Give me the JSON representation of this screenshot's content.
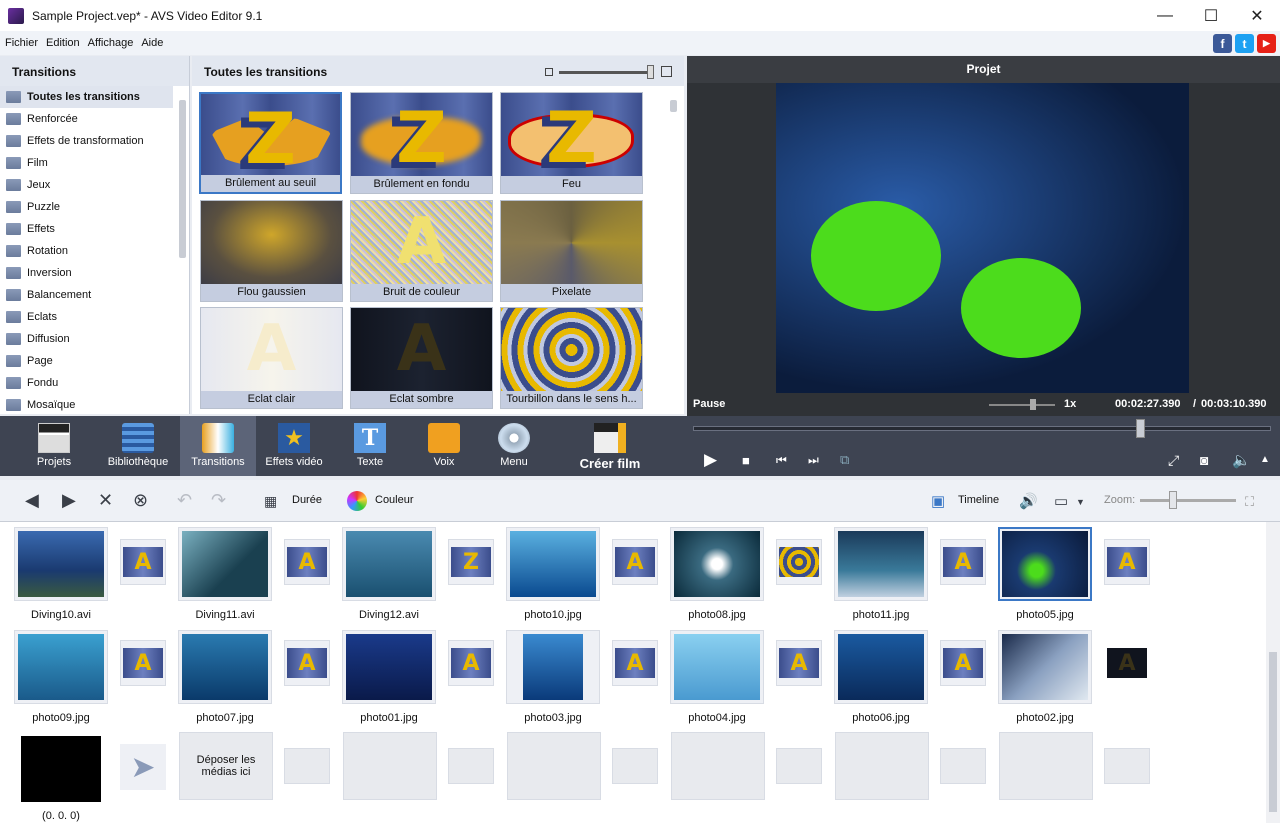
{
  "window": {
    "title": "Sample Project.vep* - AVS Video Editor 9.1",
    "minimize": "—",
    "maximize": "☐",
    "close": "✕"
  },
  "menu": [
    "Fichier",
    "Edition",
    "Affichage",
    "Aide"
  ],
  "social": {
    "facebook": "f",
    "twitter": "t",
    "youtube": "▶"
  },
  "left": {
    "header": "Transitions",
    "items": [
      "Toutes les transitions",
      "Renforcée",
      "Effets de transformation",
      "Film",
      "Jeux",
      "Puzzle",
      "Effets",
      "Rotation",
      "Inversion",
      "Balancement",
      "Eclats",
      "Diffusion",
      "Page",
      "Fondu",
      "Mosaïque"
    ]
  },
  "grid": {
    "header": "Toutes les transitions",
    "tiles": [
      "Brûlement au seuil",
      "Brûlement en fondu",
      "Feu",
      "Flou gaussien",
      "Bruit de couleur",
      "Pixelate",
      "Eclat clair",
      "Eclat sombre",
      "Tourbillon dans le sens h..."
    ]
  },
  "preview": {
    "header": "Projet",
    "status": "Pause",
    "speed": "1x",
    "time_current": "00:02:27.390",
    "time_sep": "/",
    "time_total": "00:03:10.390"
  },
  "tabs": [
    {
      "label": "Projets",
      "icon": "clapper-icon"
    },
    {
      "label": "Bibliothèque",
      "icon": "film-library-icon"
    },
    {
      "label": "Transitions",
      "icon": "transitions-icon"
    },
    {
      "label": "Effets vidéo",
      "icon": "star-effects-icon"
    },
    {
      "label": "Texte",
      "icon": "text-icon"
    },
    {
      "label": "Voix",
      "icon": "microphone-icon"
    },
    {
      "label": "Menu",
      "icon": "disc-menu-icon"
    },
    {
      "label": "Créer film",
      "icon": "create-movie-icon"
    }
  ],
  "toolbar": {
    "duration": "Durée",
    "color": "Couleur",
    "timeline": "Timeline",
    "zoom": "Zoom:"
  },
  "story": {
    "row1": [
      "Diving10.avi",
      "Diving11.avi",
      "Diving12.avi",
      "photo10.jpg",
      "photo08.jpg",
      "photo11.jpg",
      "photo05.jpg"
    ],
    "row2": [
      "photo09.jpg",
      "photo07.jpg",
      "photo01.jpg",
      "photo03.jpg",
      "photo04.jpg",
      "photo06.jpg",
      "photo02.jpg"
    ],
    "black": "(0. 0. 0)",
    "drop": "Déposer les médias ici"
  },
  "colors": {
    "accent": "#3b78c6",
    "tabbar": "#3e4452",
    "preview_bg": "#2f3236"
  }
}
